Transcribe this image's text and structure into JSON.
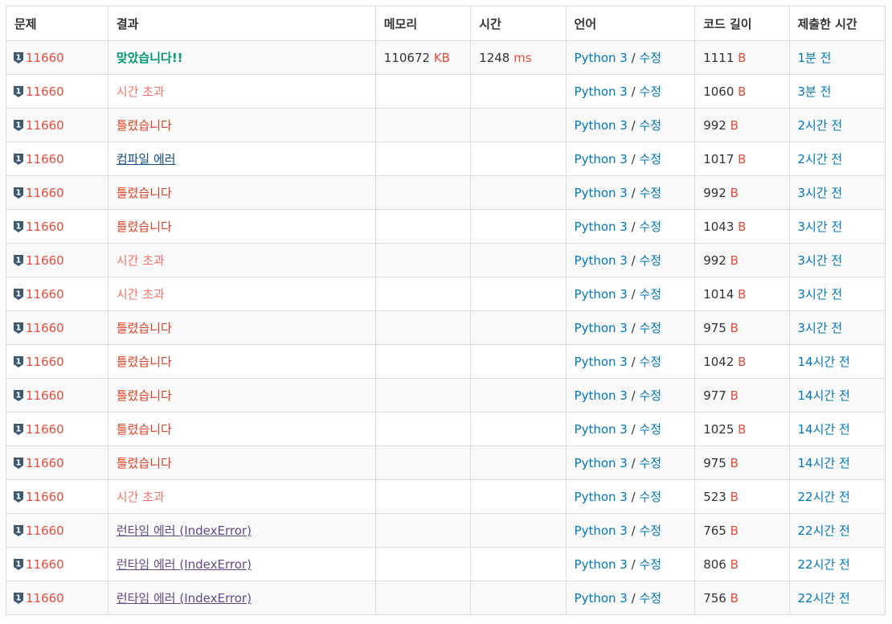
{
  "headers": {
    "problem": "문제",
    "result": "결과",
    "memory": "메모리",
    "time": "시간",
    "language": "언어",
    "code_length": "코드 길이",
    "submitted": "제출한 시간"
  },
  "units": {
    "memory": "KB",
    "time": "ms",
    "length": "B"
  },
  "separator": "/",
  "edit_label": "수정",
  "colors": {
    "accepted": "#009874",
    "wrong": "#dd4124",
    "timeout": "#fa7268",
    "compile_error": "#0f4c81",
    "runtime_error": "#5f4b8b",
    "link": "#0076c0",
    "problem_id": "#e74c3c",
    "badge": "#3f5a6e"
  },
  "badge_icon": "level-shield-icon",
  "badge_level": "1",
  "rows": [
    {
      "problem": "11660",
      "result": "맞았습니다!!",
      "result_type": "ac",
      "memory": "110672",
      "time": "1248",
      "language": "Python 3",
      "length": "1111",
      "submitted": "1분 전"
    },
    {
      "problem": "11660",
      "result": "시간 초과",
      "result_type": "tle",
      "memory": "",
      "time": "",
      "language": "Python 3",
      "length": "1060",
      "submitted": "3분 전"
    },
    {
      "problem": "11660",
      "result": "틀렸습니다",
      "result_type": "wa",
      "memory": "",
      "time": "",
      "language": "Python 3",
      "length": "992",
      "submitted": "2시간 전"
    },
    {
      "problem": "11660",
      "result": "컴파일 에러",
      "result_type": "ce",
      "memory": "",
      "time": "",
      "language": "Python 3",
      "length": "1017",
      "submitted": "2시간 전"
    },
    {
      "problem": "11660",
      "result": "틀렸습니다",
      "result_type": "wa",
      "memory": "",
      "time": "",
      "language": "Python 3",
      "length": "992",
      "submitted": "3시간 전"
    },
    {
      "problem": "11660",
      "result": "틀렸습니다",
      "result_type": "wa",
      "memory": "",
      "time": "",
      "language": "Python 3",
      "length": "1043",
      "submitted": "3시간 전"
    },
    {
      "problem": "11660",
      "result": "시간 초과",
      "result_type": "tle",
      "memory": "",
      "time": "",
      "language": "Python 3",
      "length": "992",
      "submitted": "3시간 전"
    },
    {
      "problem": "11660",
      "result": "시간 초과",
      "result_type": "tle",
      "memory": "",
      "time": "",
      "language": "Python 3",
      "length": "1014",
      "submitted": "3시간 전"
    },
    {
      "problem": "11660",
      "result": "틀렸습니다",
      "result_type": "wa",
      "memory": "",
      "time": "",
      "language": "Python 3",
      "length": "975",
      "submitted": "3시간 전"
    },
    {
      "problem": "11660",
      "result": "틀렸습니다",
      "result_type": "wa",
      "memory": "",
      "time": "",
      "language": "Python 3",
      "length": "1042",
      "submitted": "14시간 전"
    },
    {
      "problem": "11660",
      "result": "틀렸습니다",
      "result_type": "wa",
      "memory": "",
      "time": "",
      "language": "Python 3",
      "length": "977",
      "submitted": "14시간 전"
    },
    {
      "problem": "11660",
      "result": "틀렸습니다",
      "result_type": "wa",
      "memory": "",
      "time": "",
      "language": "Python 3",
      "length": "1025",
      "submitted": "14시간 전"
    },
    {
      "problem": "11660",
      "result": "틀렸습니다",
      "result_type": "wa",
      "memory": "",
      "time": "",
      "language": "Python 3",
      "length": "975",
      "submitted": "14시간 전"
    },
    {
      "problem": "11660",
      "result": "시간 초과",
      "result_type": "tle",
      "memory": "",
      "time": "",
      "language": "Python 3",
      "length": "523",
      "submitted": "22시간 전"
    },
    {
      "problem": "11660",
      "result": "런타임 에러 (IndexError)",
      "result_type": "re",
      "memory": "",
      "time": "",
      "language": "Python 3",
      "length": "765",
      "submitted": "22시간 전"
    },
    {
      "problem": "11660",
      "result": "런타임 에러 (IndexError)",
      "result_type": "re",
      "memory": "",
      "time": "",
      "language": "Python 3",
      "length": "806",
      "submitted": "22시간 전"
    },
    {
      "problem": "11660",
      "result": "런타임 에러 (IndexError)",
      "result_type": "re",
      "memory": "",
      "time": "",
      "language": "Python 3",
      "length": "756",
      "submitted": "22시간 전"
    }
  ]
}
